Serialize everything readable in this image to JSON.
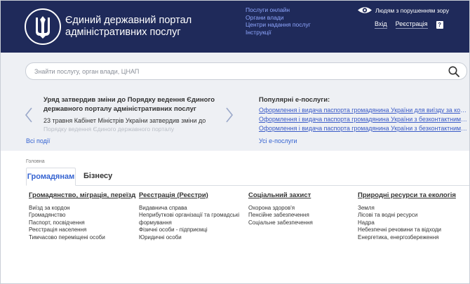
{
  "header": {
    "title": "Єдиний державний портал адміністративних послуг",
    "top_links": [
      "Послуги онлайн",
      "Органи влади",
      "Центри надання послуг",
      "Інструкції"
    ],
    "vision_label": "Людям з порушенням зору",
    "login_label": "Вхід",
    "register_label": "Реєстрація",
    "help_icon": "?"
  },
  "search": {
    "placeholder": "Знайти послугу, орган влади, ЦНАП"
  },
  "news": {
    "headline": "Уряд затвердив зміни до Порядку ведення Єдиного державного порталу адміністративних послуг",
    "lead": "23 травня Кабінет Міністрів України затвердив зміни до",
    "fade": "Порядку ведення Єдиного державного порталу",
    "all_events_label": "Всі події"
  },
  "popular": {
    "title": "Популярні е-послуги:",
    "items": [
      "Оформлення і видача паспорта громадянина України для виїзду за кордон",
      "Оформлення і видача паспорта громадянина України з безконтактним електронним носієм",
      "Оформлення і видача паспорта громадянина України з безконтактним електронним носієм"
    ],
    "all_services_label": "Усі е-послуги"
  },
  "breadcrumb": "Головна",
  "tabs": [
    {
      "label": "Громадянам",
      "active": true
    },
    {
      "label": "Бізнесу",
      "active": false
    }
  ],
  "categories": [
    {
      "title": "Громадянство, міграція, переїзд",
      "items": [
        "Виїзд за кордон",
        "Громадянство",
        "Паспорт, посвідчення",
        "Реєстрація населення",
        "Тимчасово переміщені особи"
      ]
    },
    {
      "title": "Реєстрація (Реєстри)",
      "items": [
        "Видавнича справа",
        "Неприбуткові організації та громадські формування",
        "Фізичні особи - підприємці",
        "Юридичні особи"
      ]
    },
    {
      "title": "Соціальний захист",
      "items": [
        "Охорона здоров'я",
        "Пенсійне забезпечення",
        "Соціальне забезпечення"
      ]
    },
    {
      "title": "Природні ресурси та екологія",
      "items": [
        "Земля",
        "Лісові та водні ресурси",
        "Надра",
        "Небезпечні речовини та відходи",
        "Енергетика, енергозбереження"
      ]
    }
  ],
  "colors": {
    "header_bg": "#1f2a5a",
    "link": "#3563d1",
    "band_bg": "#eef0f4"
  },
  "icons": [
    "trident-emblem-icon",
    "eye-icon",
    "help-icon",
    "search-icon",
    "chevron-left-icon",
    "chevron-right-icon"
  ]
}
